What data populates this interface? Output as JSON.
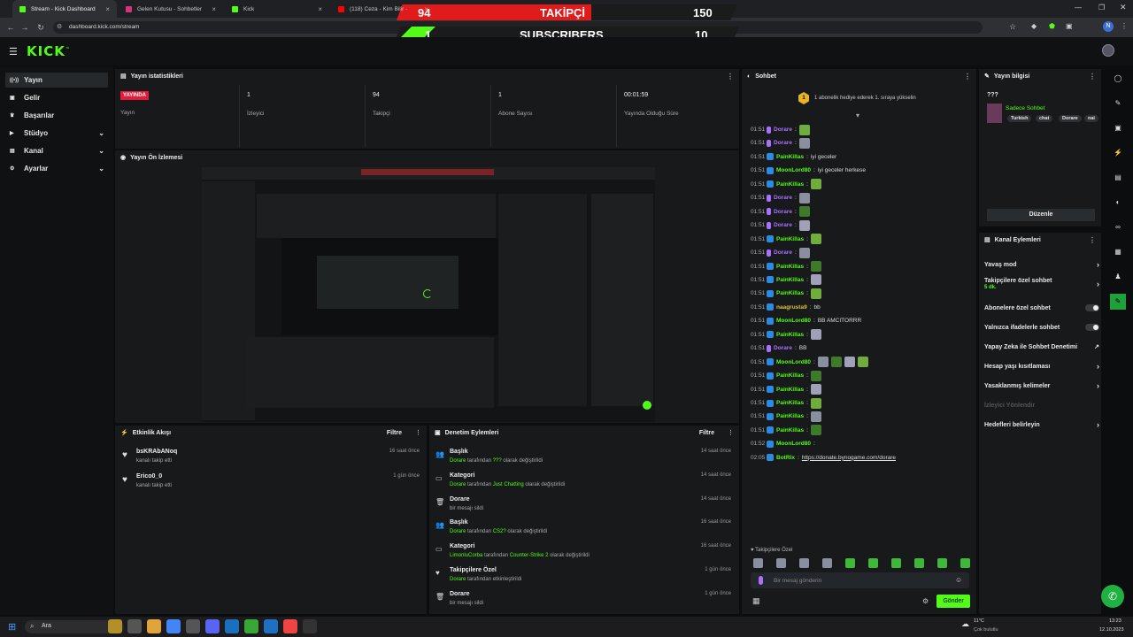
{
  "browser": {
    "tabs": [
      {
        "label": "Stream - Kick Dashboard",
        "favicon_color": "#53fc18",
        "active": true
      },
      {
        "label": "Gelen Kutusu - Sohbetler",
        "favicon_color": "#d8327a",
        "active": false
      },
      {
        "label": "Kick",
        "favicon_color": "#53fc18",
        "active": false
      },
      {
        "label": "(118) Ceza - Kim Bilir -",
        "favicon_color": "#ff0000",
        "active": false
      }
    ],
    "url": "dashboard.kick.com/stream",
    "profile_initial": "N"
  },
  "overlay": {
    "followers_current": "94",
    "followers_label": "TAKİPÇİ",
    "followers_goal": "150",
    "subs_current": "1",
    "subs_label": "SUBSCRIBERS",
    "subs_goal": "10"
  },
  "app": {
    "logo": "KICK",
    "logo_tm": "™",
    "accent": "#53fc18"
  },
  "sidebar": {
    "items": [
      {
        "label": "Yayın",
        "icon": "broadcast-icon",
        "active": true,
        "expandable": false
      },
      {
        "label": "Gelir",
        "icon": "wallet-icon",
        "active": false,
        "expandable": false
      },
      {
        "label": "Başarılar",
        "icon": "trophy-icon",
        "active": false,
        "expandable": false
      },
      {
        "label": "Stüdyo",
        "icon": "studio-icon",
        "active": false,
        "expandable": true
      },
      {
        "label": "Kanal",
        "icon": "channel-icon",
        "active": false,
        "expandable": true
      },
      {
        "label": "Ayarlar",
        "icon": "gear-icon",
        "active": false,
        "expandable": true
      }
    ]
  },
  "stats": {
    "title": "Yayın istatistikleri",
    "live_badge": "YAYINDA",
    "live_label": "Yayın",
    "items": [
      {
        "value": "1",
        "label": "İzleyici"
      },
      {
        "value": "94",
        "label": "Takipçi"
      },
      {
        "value": "1",
        "label": "Abone Sayısı"
      },
      {
        "value": "00:01:59",
        "label": "Yayında Olduğu Süre"
      }
    ]
  },
  "preview": {
    "title": "Yayın Ön İzlemesi"
  },
  "activity": {
    "title": "Etkinlik Akışı",
    "filter": "Filtre",
    "items": [
      {
        "name": "bsKRAbANoq",
        "sub": "kanalı takip etti",
        "time": "16 saat önce"
      },
      {
        "name": "Erico0_0",
        "sub": "kanalı takip etti",
        "time": "1 gün önce"
      }
    ]
  },
  "moderation": {
    "title": "Denetim Eylemleri",
    "filter": "Filtre",
    "items": [
      {
        "icon": "users-icon",
        "title": "Başlık",
        "actor": "Dorare",
        "mid": "tarafından",
        "value": "???",
        "tail": "olarak değiştirildi",
        "time": "14 saat önce"
      },
      {
        "icon": "category-icon",
        "title": "Kategori",
        "actor": "Dorare",
        "mid": "tarafından",
        "value": "Just Chatting",
        "tail": "olarak değiştirildi",
        "time": "14 saat önce"
      },
      {
        "icon": "trash-icon",
        "title": "Dorare",
        "actor": "",
        "mid": "",
        "value": "",
        "tail": "bir mesajı sildi",
        "time": "14 saat önce"
      },
      {
        "icon": "users-icon",
        "title": "Başlık",
        "actor": "Dorare",
        "mid": "tarafından",
        "value": "CS2?",
        "tail": "olarak değiştirildi",
        "time": "16 saat önce"
      },
      {
        "icon": "category-icon",
        "title": "Kategori",
        "actor": "LimonluCorba",
        "mid": "tarafından",
        "value": "Counter-Strike 2",
        "tail": "olarak değiştirildi",
        "time": "16 saat önce"
      },
      {
        "icon": "heart-icon",
        "title": "Takipçilere Özel",
        "actor": "Dorare",
        "mid": "tarafından",
        "value": "",
        "tail": "etkinleştirildi",
        "time": "1 gün önce"
      },
      {
        "icon": "trash-icon",
        "title": "Dorare",
        "actor": "",
        "mid": "",
        "value": "",
        "tail": "bir mesajı sildi",
        "time": "1 gün önce"
      }
    ]
  },
  "chat": {
    "title": "Sohbet",
    "pinned": "1 abonelik hediye ederek 1. sıraya yükselin",
    "pinned_rank": "1",
    "messages": [
      {
        "t": "01:51",
        "user": "Dorare",
        "color": "#a970ff",
        "text": "",
        "emotes": 1
      },
      {
        "t": "01:51",
        "user": "Dorare",
        "color": "#a970ff",
        "text": "",
        "emotes": 1
      },
      {
        "t": "01:51",
        "user": "PainKillas",
        "color": "#53fc18",
        "text": "iyi geceler",
        "emotes": 0
      },
      {
        "t": "01:51",
        "user": "MoonLord80",
        "color": "#53fc18",
        "text": "iyi geceler herkese",
        "emotes": 0
      },
      {
        "t": "01:51",
        "user": "PainKillas",
        "color": "#53fc18",
        "text": "",
        "emotes": 1
      },
      {
        "t": "01:51",
        "user": "Dorare",
        "color": "#a970ff",
        "text": "",
        "emotes": 1
      },
      {
        "t": "01:51",
        "user": "Dorare",
        "color": "#a970ff",
        "text": "",
        "emotes": 1
      },
      {
        "t": "01:51",
        "user": "Dorare",
        "color": "#a970ff",
        "text": "",
        "emotes": 1
      },
      {
        "t": "01:51",
        "user": "PainKillas",
        "color": "#53fc18",
        "text": "",
        "emotes": 1
      },
      {
        "t": "01:51",
        "user": "Dorare",
        "color": "#a970ff",
        "text": "",
        "emotes": 1
      },
      {
        "t": "01:51",
        "user": "PainKillas",
        "color": "#53fc18",
        "text": "",
        "emotes": 1
      },
      {
        "t": "01:51",
        "user": "PainKillas",
        "color": "#53fc18",
        "text": "",
        "emotes": 1
      },
      {
        "t": "01:51",
        "user": "PainKillas",
        "color": "#53fc18",
        "text": "",
        "emotes": 1
      },
      {
        "t": "01:51",
        "user": "naagrusta9",
        "color": "#e0c23a",
        "text": "bb",
        "emotes": 0
      },
      {
        "t": "01:51",
        "user": "MoonLord80",
        "color": "#53fc18",
        "text": "BB AMCITORRR",
        "emotes": 0
      },
      {
        "t": "01:51",
        "user": "PainKillas",
        "color": "#53fc18",
        "text": "",
        "emotes": 1
      },
      {
        "t": "01:51",
        "user": "Dorare",
        "color": "#a970ff",
        "text": "BB",
        "emotes": 0
      },
      {
        "t": "01:51",
        "user": "MoonLord80",
        "color": "#53fc18",
        "text": "",
        "emotes": 4
      },
      {
        "t": "01:51",
        "user": "PainKillas",
        "color": "#53fc18",
        "text": "",
        "emotes": 1
      },
      {
        "t": "01:51",
        "user": "PainKillas",
        "color": "#53fc18",
        "text": "",
        "emotes": 1
      },
      {
        "t": "01:51",
        "user": "PainKillas",
        "color": "#53fc18",
        "text": "",
        "emotes": 1
      },
      {
        "t": "01:51",
        "user": "PainKillas",
        "color": "#53fc18",
        "text": "",
        "emotes": 1
      },
      {
        "t": "01:51",
        "user": "PainKillas",
        "color": "#53fc18",
        "text": "",
        "emotes": 1
      },
      {
        "t": "01:52",
        "user": "MoonLord80",
        "color": "#53fc18",
        "text": "",
        "emotes": 0
      },
      {
        "t": "02:05",
        "user": "BotRix",
        "color": "#53fc18",
        "text": "https://donate.bynogame.com/dorare",
        "emotes": 0
      }
    ],
    "followers_only": "Takipçilere Özel",
    "input_placeholder": "Bir mesaj gönderin",
    "send": "Gönder"
  },
  "stream_info": {
    "title": "Yayın bilgisi",
    "stream_title": "???",
    "category": "Sadece Sohbet",
    "tags": [
      "Turkish",
      "chat",
      "Dorare",
      "nai"
    ],
    "edit": "Düzenle"
  },
  "channel_actions": {
    "title": "Kanal Eylemleri",
    "items": [
      {
        "label": "Yavaş mod",
        "sub": "",
        "control": "chevron",
        "disabled": false
      },
      {
        "label": "Takipçilere özel sohbet",
        "sub": "5 dk.",
        "control": "chevron",
        "disabled": false
      },
      {
        "label": "Abonelere özel sohbet",
        "sub": "",
        "control": "toggle",
        "disabled": false
      },
      {
        "label": "Yalnızca ifadelerle sohbet",
        "sub": "",
        "control": "toggle",
        "disabled": false
      },
      {
        "label": "Yapay Zeka ile Sohbet Denetimi",
        "sub": "",
        "control": "external",
        "disabled": false
      },
      {
        "label": "Hesap yaşı kısıtlaması",
        "sub": "",
        "control": "chevron",
        "disabled": false
      },
      {
        "label": "Yasaklanmış kelimeler",
        "sub": "",
        "control": "chevron",
        "disabled": false
      },
      {
        "label": "İzleyici Yönlendir",
        "sub": "",
        "control": "none",
        "disabled": true
      },
      {
        "label": "Hedefleri belirleyin",
        "sub": "",
        "control": "chevron",
        "disabled": false
      }
    ]
  },
  "taskbar": {
    "search": "Ara",
    "weather_temp": "11°C",
    "weather_desc": "Çok bulutlu",
    "time": "13:23",
    "date": "12.10.2023"
  }
}
